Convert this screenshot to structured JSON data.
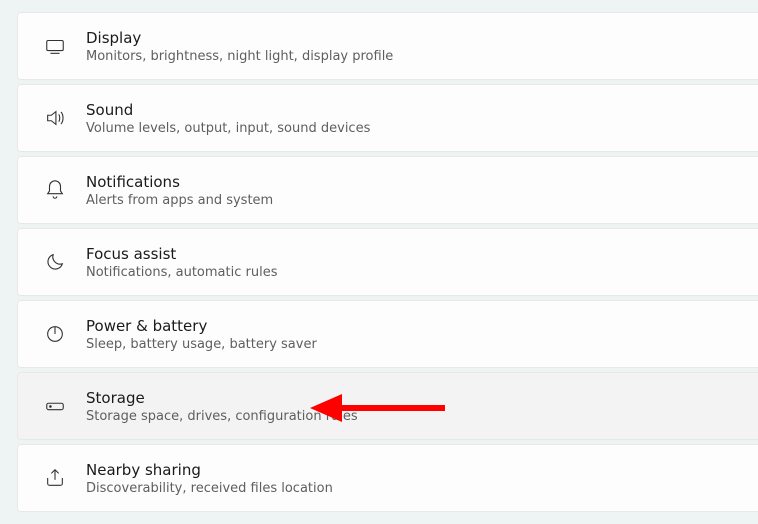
{
  "settings": {
    "items": [
      {
        "key": "display",
        "title": "Display",
        "desc": "Monitors, brightness, night light, display profile"
      },
      {
        "key": "sound",
        "title": "Sound",
        "desc": "Volume levels, output, input, sound devices"
      },
      {
        "key": "notifications",
        "title": "Notifications",
        "desc": "Alerts from apps and system"
      },
      {
        "key": "focus",
        "title": "Focus assist",
        "desc": "Notifications, automatic rules"
      },
      {
        "key": "power",
        "title": "Power & battery",
        "desc": "Sleep, battery usage, battery saver"
      },
      {
        "key": "storage",
        "title": "Storage",
        "desc": "Storage space, drives, configuration rules"
      },
      {
        "key": "nearby",
        "title": "Nearby sharing",
        "desc": "Discoverability, received files location"
      }
    ]
  },
  "annotation": {
    "arrow_color": "#ff0000",
    "points_to": "storage"
  }
}
